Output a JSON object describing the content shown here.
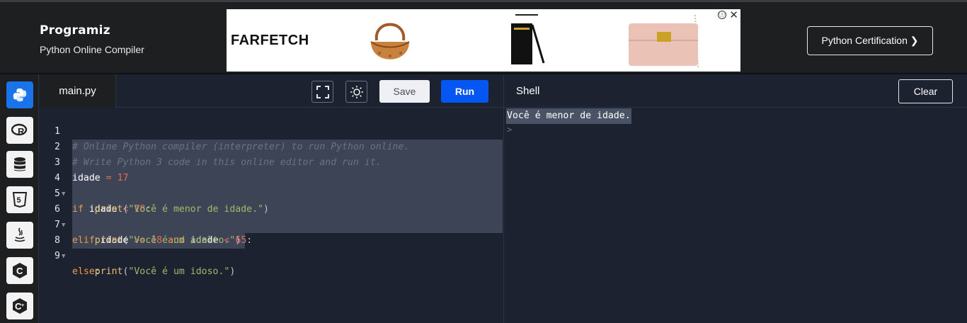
{
  "header": {
    "logo_text": "Programiz",
    "subtitle": "Python Online Compiler",
    "cert_button": "Python Certification ❯"
  },
  "ad": {
    "brand": "FARFETCH",
    "info_icon": "ⓘ",
    "close_icon": "✕"
  },
  "sidebar": {
    "items": [
      {
        "name": "python",
        "icon": "python-icon",
        "active": true
      },
      {
        "name": "r",
        "icon": "r-icon"
      },
      {
        "name": "sql",
        "icon": "database-icon"
      },
      {
        "name": "html",
        "icon": "html5-icon"
      },
      {
        "name": "java",
        "icon": "java-icon"
      },
      {
        "name": "c",
        "icon": "c-icon"
      },
      {
        "name": "cpp",
        "icon": "cpp-icon"
      }
    ]
  },
  "editor": {
    "tab_label": "main.py",
    "save_label": "Save",
    "run_label": "Run",
    "line_numbers": [
      "1",
      "2",
      "3",
      "4",
      "5",
      "6",
      "7",
      "8",
      "9"
    ],
    "lines": [
      "# Online Python compiler (interpreter) to run Python online.",
      "# Write Python 3 code in this online editor and run it.",
      "idade = 17",
      "if idade < 18:",
      "    print(\"Você é menor de idade.\")",
      "elif idade >= 18 and idade < 65:",
      "    print(\"Você é um adulto.\")",
      "else:",
      "    print(\"Você é um idoso.\")"
    ]
  },
  "shell": {
    "title": "Shell",
    "clear_label": "Clear",
    "output": "Você é menor de idade.",
    "prompt": ">"
  },
  "colors": {
    "accent": "#0556f3",
    "editor_bg": "#1d2230",
    "header_bg": "#1e1f21"
  }
}
